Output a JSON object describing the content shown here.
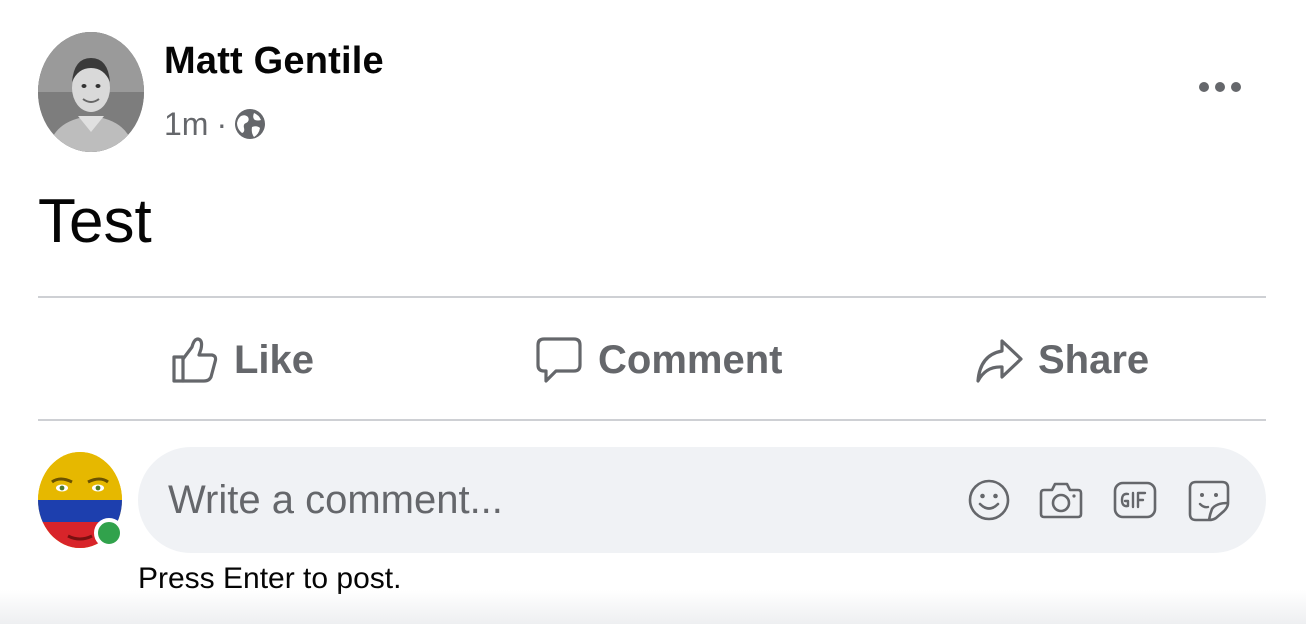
{
  "post": {
    "author_name": "Matt Gentile",
    "timestamp": "1m",
    "separator": "·",
    "privacy_icon": "globe-icon",
    "body_text": "Test"
  },
  "actions": {
    "like_label": "Like",
    "comment_label": "Comment",
    "share_label": "Share"
  },
  "composer": {
    "placeholder": "Write a comment...",
    "hint": "Press Enter to post.",
    "tools": [
      "emoji-icon",
      "camera-icon",
      "gif-icon",
      "sticker-icon"
    ]
  },
  "colors": {
    "secondary_text": "#65676b",
    "input_background": "#f0f2f5",
    "divider": "#ced0d4",
    "online": "#31a24c"
  }
}
